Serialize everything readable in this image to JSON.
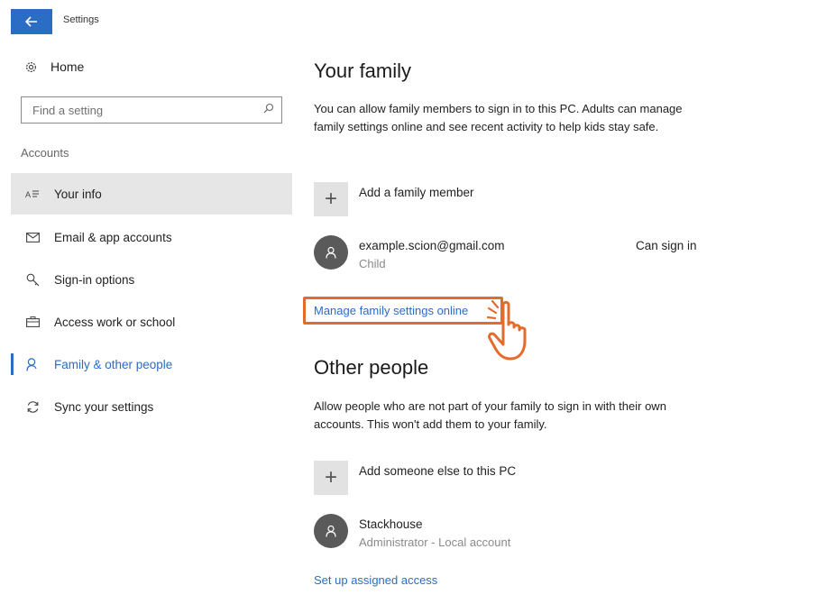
{
  "window": {
    "title": "Settings",
    "back_icon": "arrow-left-icon"
  },
  "sidebar": {
    "home_label": "Home",
    "search_placeholder": "Find a setting",
    "section_label": "Accounts",
    "items": [
      {
        "label": "Your info",
        "icon": "person-card-icon",
        "selected": true
      },
      {
        "label": "Email & app accounts",
        "icon": "mail-icon"
      },
      {
        "label": "Sign-in options",
        "icon": "key-icon"
      },
      {
        "label": "Access work or school",
        "icon": "briefcase-icon"
      },
      {
        "label": "Family & other people",
        "icon": "person-icon",
        "active": true
      },
      {
        "label": "Sync your settings",
        "icon": "sync-icon"
      }
    ]
  },
  "family": {
    "heading": "Your family",
    "description": "You can allow family members to sign in to this PC. Adults can manage family settings online and see recent activity to help kids stay safe.",
    "add_label": "Add a family member",
    "member": {
      "name": "example.scion@gmail.com",
      "role": "Child",
      "status": "Can sign in"
    },
    "manage_link": "Manage family settings online"
  },
  "other": {
    "heading": "Other people",
    "description": "Allow people who are not part of your family to sign in with their own accounts. This won't add them to your family.",
    "add_label": "Add someone else to this PC",
    "person": {
      "name": "Stackhouse",
      "role": "Administrator - Local account"
    },
    "assigned_access_link": "Set up assigned access"
  },
  "colors": {
    "accent": "#2b6cc4",
    "highlight": "#e36c2d"
  }
}
